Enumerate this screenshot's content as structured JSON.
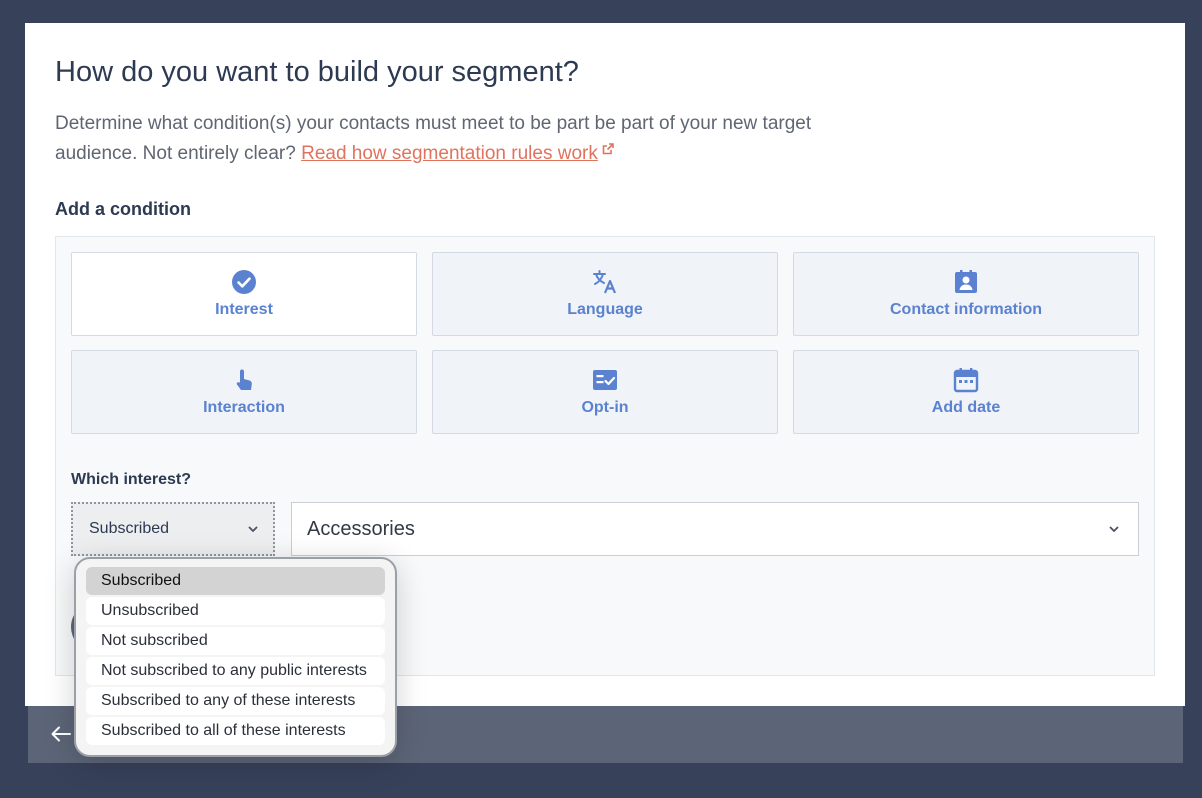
{
  "modal": {
    "title": "How do you want to build your segment?",
    "description": "Determine what condition(s) your contacts must meet to be part be part of your new target audience. Not entirely clear?",
    "help_link": "Read how segmentation rules work"
  },
  "conditions": {
    "heading": "Add a condition",
    "tiles": [
      {
        "label": "Interest",
        "icon": "check-circle-icon",
        "selected": true
      },
      {
        "label": "Language",
        "icon": "translate-icon",
        "selected": false
      },
      {
        "label": "Contact information",
        "icon": "contact-card-icon",
        "selected": false
      },
      {
        "label": "Interaction",
        "icon": "tap-icon",
        "selected": false
      },
      {
        "label": "Opt-in",
        "icon": "checklist-icon",
        "selected": false
      },
      {
        "label": "Add date",
        "icon": "calendar-icon",
        "selected": false
      }
    ]
  },
  "interest": {
    "question": "Which interest?",
    "mode_value": "Subscribed",
    "interest_value": "Accessories",
    "mode_options": [
      "Subscribed",
      "Unsubscribed",
      "Not subscribed",
      "Not subscribed to any public interests",
      "Subscribed to any of these interests",
      "Subscribed to all of these interests"
    ],
    "active_option": "Subscribed"
  },
  "colors": {
    "accent": "#5b82d0",
    "link": "#e0735d",
    "backdrop": "#37415a",
    "footer": "#5c6577"
  }
}
